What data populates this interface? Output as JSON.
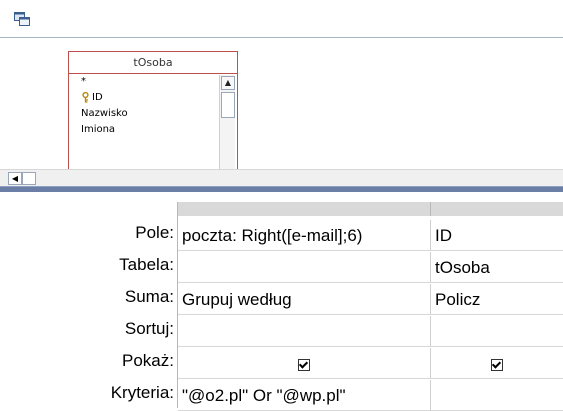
{
  "toolbar": {
    "icon": "query-design-icon"
  },
  "field_list": {
    "title": "tOsoba",
    "items": [
      {
        "label": "*",
        "key": false
      },
      {
        "label": "ID",
        "key": true
      },
      {
        "label": "Nazwisko",
        "key": false
      },
      {
        "label": "Imiona",
        "key": false
      }
    ]
  },
  "grid": {
    "row_labels": {
      "field": "Pole:",
      "table": "Tabela:",
      "total": "Suma:",
      "sort": "Sortuj:",
      "show": "Pokaż:",
      "criteria": "Kryteria:"
    },
    "columns": [
      {
        "field": "poczta: Right([e-mail];6)",
        "table": "",
        "total": "Grupuj według",
        "sort": "",
        "show": true,
        "criteria": "\"@o2.pl\" Or \"@wp.pl\""
      },
      {
        "field": "ID",
        "table": "tOsoba",
        "total": "Policz",
        "sort": "",
        "show": true,
        "criteria": ""
      }
    ]
  }
}
